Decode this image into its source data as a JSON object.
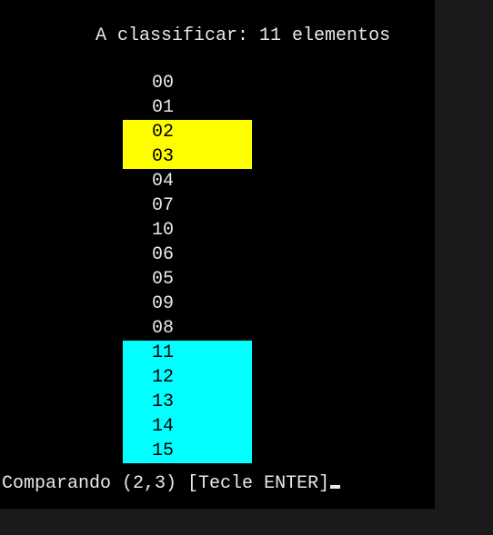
{
  "header": {
    "prefix": "A classificar: ",
    "count": "11",
    "suffix": " elementos"
  },
  "items": [
    {
      "value": "00",
      "highlight": "none"
    },
    {
      "value": "01",
      "highlight": "none"
    },
    {
      "value": "02",
      "highlight": "yellow"
    },
    {
      "value": "03",
      "highlight": "yellow"
    },
    {
      "value": "04",
      "highlight": "none"
    },
    {
      "value": "07",
      "highlight": "none"
    },
    {
      "value": "10",
      "highlight": "none"
    },
    {
      "value": "06",
      "highlight": "none"
    },
    {
      "value": "05",
      "highlight": "none"
    },
    {
      "value": "09",
      "highlight": "none"
    },
    {
      "value": "08",
      "highlight": "none"
    },
    {
      "value": "11",
      "highlight": "cyan"
    },
    {
      "value": "12",
      "highlight": "cyan"
    },
    {
      "value": "13",
      "highlight": "cyan"
    },
    {
      "value": "14",
      "highlight": "cyan"
    },
    {
      "value": "15",
      "highlight": "cyan"
    }
  ],
  "footer": {
    "prefix": "Comparando ",
    "pair": "(2,3)",
    "suffix": " [Tecle ENTER]"
  }
}
